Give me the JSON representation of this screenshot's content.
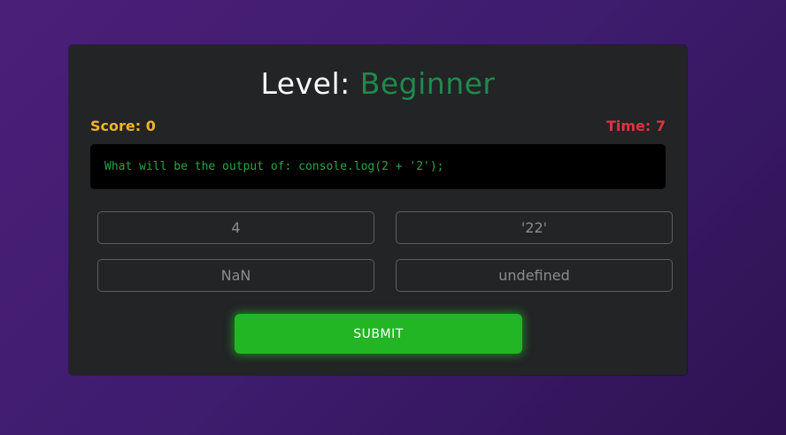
{
  "header": {
    "level_label": "Level:",
    "level_value": "Beginner"
  },
  "status": {
    "score": "Score: 0",
    "time": "Time: 7"
  },
  "question": {
    "text": "What will be the output of: console.log(2 + '2');"
  },
  "options": [
    {
      "label": "4"
    },
    {
      "label": "'22'"
    },
    {
      "label": "NaN"
    },
    {
      "label": "undefined"
    }
  ],
  "submit": {
    "label": "SUBMIT"
  },
  "colors": {
    "background": "#3e1c6e",
    "card": "#222426",
    "level_accent": "#1f8a4c",
    "score": "#f0b429",
    "time": "#e0343d",
    "code_text": "#22a845",
    "submit": "#22b524"
  }
}
